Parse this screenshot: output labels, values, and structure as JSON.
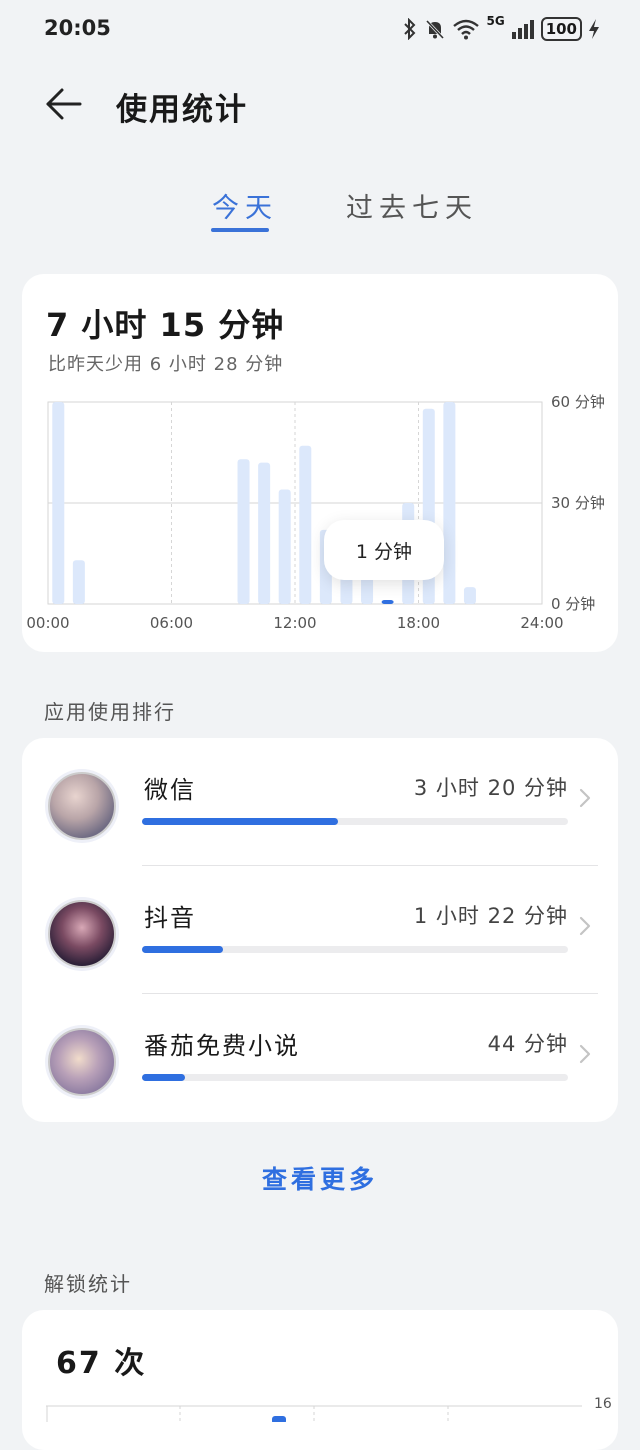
{
  "status_bar": {
    "time": "20:05",
    "signal_label": "5G",
    "battery": "100"
  },
  "header": {
    "title": "使用统计"
  },
  "tabs": [
    {
      "label": "今天",
      "active": true
    },
    {
      "label": "过去七天",
      "active": false
    }
  ],
  "usage": {
    "total": "7 小时 15 分钟",
    "compare": "比昨天少用 6 小时 28 分钟",
    "tooltip": "1 分钟"
  },
  "chart_data": {
    "type": "bar",
    "x_ticks": [
      "00:00",
      "06:00",
      "12:00",
      "18:00",
      "24:00"
    ],
    "y_ticks": [
      "60 分钟",
      "30 分钟",
      "0 分钟"
    ],
    "ylim": [
      0,
      60
    ],
    "x_hours": [
      0.5,
      1.5,
      9.5,
      10.5,
      11.5,
      12.5,
      13.5,
      14.5,
      15.5,
      16.5,
      17.5,
      18.5,
      19.5,
      20.5
    ],
    "values": [
      60,
      13,
      43,
      42,
      34,
      47,
      22,
      10,
      8,
      1,
      30,
      58,
      60,
      5
    ],
    "highlighted_index": 9,
    "colors": {
      "bar": "#dce8fb",
      "highlight": "#2f6fe0",
      "grid": "#d6d6d6"
    }
  },
  "ranking": {
    "title": "应用使用排行",
    "items": [
      {
        "name": "微信",
        "time": "3 小时 20 分钟",
        "progress": 0.46
      },
      {
        "name": "抖音",
        "time": "1 小时 22 分钟",
        "progress": 0.19
      },
      {
        "name": "番茄免费小说",
        "time": "44 分钟",
        "progress": 0.1
      }
    ],
    "more": "查看更多"
  },
  "unlock": {
    "title": "解锁统计",
    "count": "67 次",
    "axis_top": "16"
  }
}
